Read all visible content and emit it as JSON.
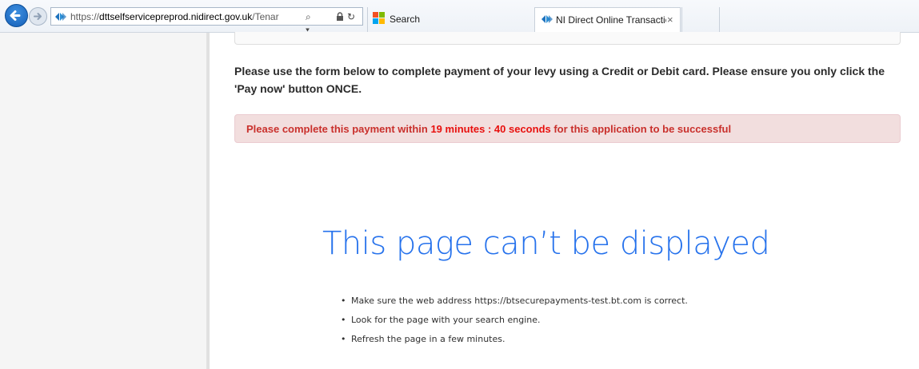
{
  "browser": {
    "url_prefix": "https://",
    "url_domain": "dttselfservicepreprod.nidirect.gov.uk",
    "url_path": "/Tenar",
    "search_dropdown": "⌕ ▾",
    "lock": "🔒",
    "refresh": "↻",
    "tabs": [
      {
        "label": "Search",
        "icon": "bing-search-icon"
      },
      {
        "label": "NI Direct Online Transactio...",
        "icon": "nidirect-icon",
        "active": true,
        "close": "×"
      }
    ]
  },
  "page": {
    "intro": "Please use the form below to complete payment of your levy using a Credit or Debit card. Please ensure you only click the 'Pay now' button ONCE.",
    "alert": {
      "before": "Please complete this payment within ",
      "timer": "19 minutes : 40 seconds",
      "after": " for this application to be successful"
    },
    "error": {
      "heading": "This page can’t be displayed",
      "items": [
        "Make sure the web address https://btsecurepayments-test.bt.com is correct.",
        "Look for the page with your search engine.",
        "Refresh the page in a few minutes."
      ]
    }
  },
  "colors": {
    "accent": "#2672ec",
    "alert_bg": "#f2dede",
    "alert_text": "#c9302c",
    "timer_text": "#e8100e"
  }
}
